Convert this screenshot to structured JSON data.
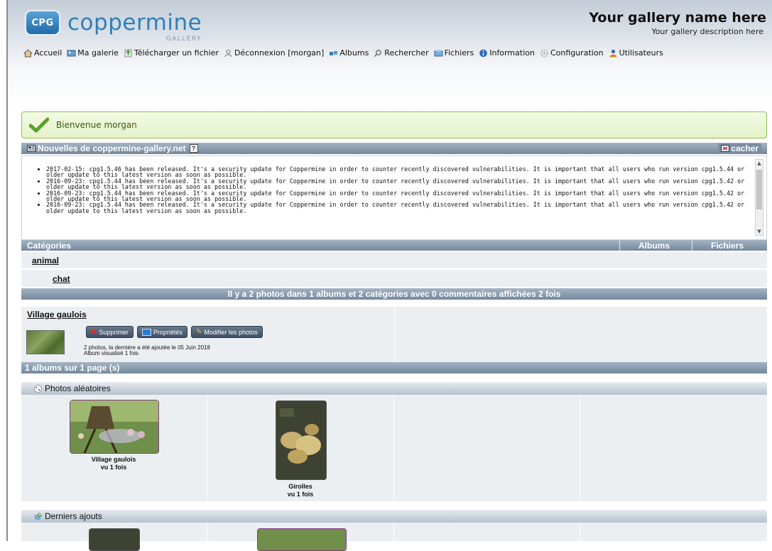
{
  "header": {
    "logo_badge": "CPG",
    "logo_text": "coppermine",
    "logo_sub": "GALLERY",
    "gallery_name": "Your gallery name here",
    "gallery_description": "Your gallery description here"
  },
  "nav": [
    {
      "label": "Accueil",
      "icon": "home-icon",
      "color": "#7a6a4a"
    },
    {
      "label": "Ma galerie",
      "icon": "gallery-icon",
      "color": "#3f7fb8"
    },
    {
      "label": "Télécharger un fichier",
      "icon": "upload-icon",
      "color": "#4a9a3a"
    },
    {
      "label": "Déconnexion [morgan]",
      "icon": "logout-icon",
      "color": "#8a8a8a"
    },
    {
      "label": "Albums",
      "icon": "albums-icon",
      "color": "#4a7ab0"
    },
    {
      "label": "Rechercher",
      "icon": "search-icon",
      "color": "#777777"
    },
    {
      "label": "Fichiers",
      "icon": "files-icon",
      "color": "#5a8ac0"
    },
    {
      "label": "Information",
      "icon": "info-icon",
      "color": "#2a6ab0"
    },
    {
      "label": "Configuration",
      "icon": "config-icon",
      "color": "#b0b0b0"
    },
    {
      "label": "Utilisateurs",
      "icon": "users-icon",
      "color": "#3a6aa8"
    }
  ],
  "welcome": {
    "text": "Bienvenue morgan"
  },
  "news": {
    "title": "Nouvelles de coppermine-gallery.net",
    "help": "?",
    "hide_label": "cacher",
    "items": [
      "2017-02-15: cpg1.5.46 has been released. It's a security update for Coppermine in order to counter recently discovered vulnerabilities. It is important that all users who run version cpg1.5.44 or older update to this latest version as soon as possible.",
      "2016-09-23: cpg1.5.44 has been released. It's a security update for Coppermine in order to counter recently discovered vulnerabilities. It is important that all users who run version cpg1.5.42 or older update to this latest version as soon as possible.",
      "2016-09-23: cpg1.5.44 has been released. It's a security update for Coppermine in order to counter recently discovered vulnerabilities. It is important that all users who run version cpg1.5.42 or older update to this latest version as soon as possible.",
      "2016-09-23: cpg1.5.44 has been released. It's a security update for Coppermine in order to counter recently discovered vulnerabilities. It is important that all users who run version cpg1.5.42 or older update to this latest version as soon as possible."
    ]
  },
  "categories": {
    "header": {
      "name": "Catégories",
      "albums": "Albums",
      "files": "Fichiers"
    },
    "rows": [
      {
        "name": "animal"
      },
      {
        "name": "chat"
      }
    ],
    "stats": "Il y a 2 photos dans 1 albums et 2 catégories avec 0 commentaires affichées 2 fois"
  },
  "album": {
    "title": "Village gaulois",
    "buttons": {
      "delete": "Supprimer",
      "properties": "Propriétés",
      "edit": "Modifier les photos"
    },
    "info_line1": "2 photos, la dernière a été ajoutée le 05 Juin 2018",
    "info_line2": "Album visualisé 1 fois"
  },
  "pages": "1 albums sur 1 page (s)",
  "random": {
    "title": "Photos aléatoires",
    "items": [
      {
        "name": "Village gaulois",
        "views": "vu 1 fois"
      },
      {
        "name": "Girolles",
        "views": "vu 1 fois"
      }
    ]
  },
  "latest": {
    "title": "Derniers ajouts"
  }
}
